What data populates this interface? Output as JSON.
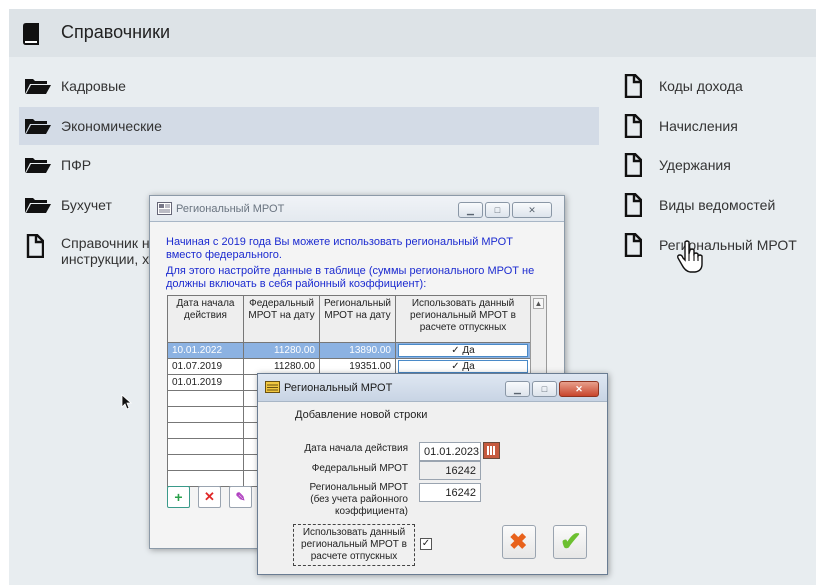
{
  "header": {
    "title": "Справочники"
  },
  "left_nav": [
    {
      "label": "Кадровые",
      "icon": "folder-icon"
    },
    {
      "label": "Экономические",
      "icon": "folder-icon",
      "active": true
    },
    {
      "label": "ПФР",
      "icon": "folder-icon"
    },
    {
      "label": "Бухучет",
      "icon": "folder-icon"
    },
    {
      "label_line1": "Справочник на",
      "label_line2": "инструкции, xs",
      "icon": "document-icon"
    }
  ],
  "right_nav": [
    {
      "label": "Коды дохода"
    },
    {
      "label": "Начисления"
    },
    {
      "label": "Удержания"
    },
    {
      "label": "Виды ведомостей"
    },
    {
      "label": "Региональный МРОТ"
    }
  ],
  "window_main": {
    "title": "Региональный МРОТ",
    "info_line1": "Начиная с 2019 года Вы можете использовать региональный МРОТ",
    "info_line2": "вместо федерального.",
    "info_line3": "Для этого настройте данные в таблице (суммы регионального МРОТ не",
    "info_line4": "должны включать в себя районный коэффициент):",
    "columns": {
      "c1_l1": "Дата начала",
      "c1_l2": "действия",
      "c2_l1": "Федеральный",
      "c2_l2": "МРОТ на дату",
      "c3_l1": "Региональный",
      "c3_l2": "МРОТ на дату",
      "c4_l1": "Использовать данный",
      "c4_l2": "региональный МРОТ в",
      "c4_l3": "расчете отпускных"
    },
    "rows": [
      {
        "date": "10.01.2022",
        "federal": "11280.00",
        "regional": "13890.00",
        "use": "✓ Да"
      },
      {
        "date": "01.07.2019",
        "federal": "11280.00",
        "regional": "19351.00",
        "use": "✓ Да"
      },
      {
        "date": "01.01.2019",
        "federal": "",
        "regional": "",
        "use": ""
      }
    ]
  },
  "window_add": {
    "title": "Региональный МРОТ",
    "subheading": "Добавление новой строки",
    "date_label": "Дата начала действия",
    "date_value": "01.01.2023",
    "federal_label": "Федеральный МРОТ",
    "federal_value": "16242",
    "regional_label_l1": "Региональный МРОТ",
    "regional_label_l2": "(без учета районного",
    "regional_label_l3": "коэффициента)",
    "regional_value": "16242",
    "use_label_l1": "Использовать данный",
    "use_label_l2": "региональный МРОТ в",
    "use_label_l3": "расчете отпускных",
    "use_checked": "✓"
  },
  "colors": {
    "accent_blue": "#1c2bd0",
    "selection": "#8cb2e2",
    "nav_active": "#d3dbe6"
  }
}
